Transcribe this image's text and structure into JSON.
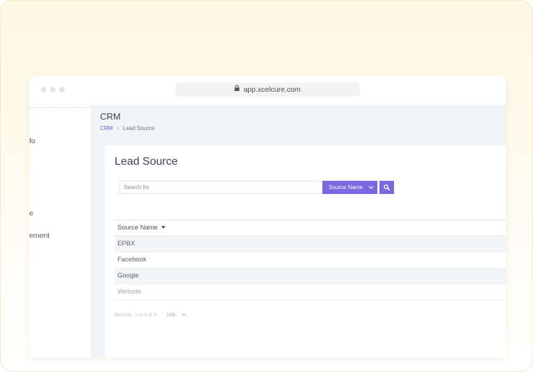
{
  "browser": {
    "url": "app.xcelcure.com"
  },
  "sidebar": {
    "items": [
      {
        "label": "fo"
      },
      {
        "label": "e"
      },
      {
        "label": "ement"
      }
    ]
  },
  "header": {
    "title": "CRM",
    "breadcrumb": {
      "root": "CRM",
      "current": "Lead Source"
    }
  },
  "main": {
    "title": "Lead Source",
    "search": {
      "placeholder": "Search for",
      "field_select": "Source Name"
    },
    "table": {
      "column": "Source Name",
      "rows": [
        "EPBX",
        "Facebook",
        "Google",
        "Website"
      ]
    },
    "pagination": {
      "records": "Records: 1 to 4 of 4",
      "per_page": "10/b"
    }
  },
  "colors": {
    "accent": "#7b68e0",
    "content_bg": "#f1f5f8"
  },
  "icons": [
    "lock-icon",
    "search-icon",
    "chevron-down-icon",
    "sort-caret-icon"
  ]
}
